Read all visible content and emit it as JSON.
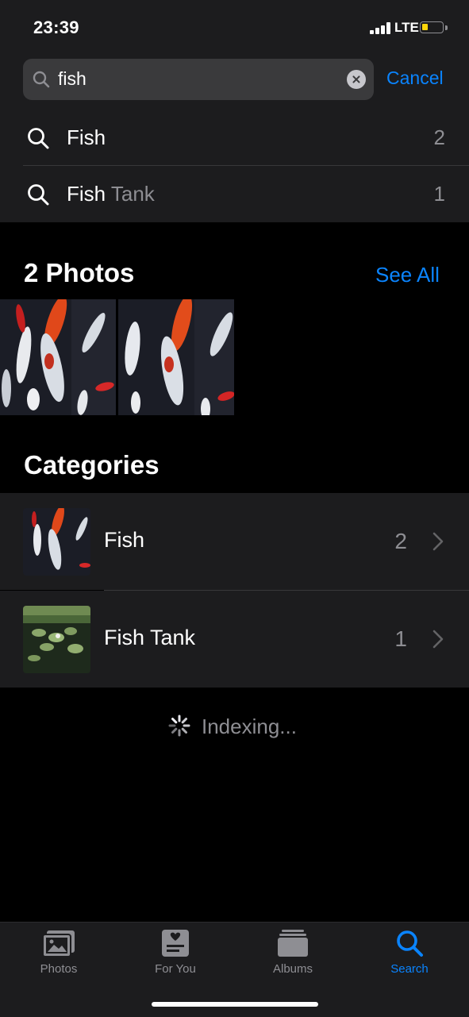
{
  "status_bar": {
    "time": "23:39",
    "network": "LTE"
  },
  "search": {
    "query": "fish",
    "cancel_label": "Cancel"
  },
  "suggestions": [
    {
      "label": "Fish",
      "suffix": "",
      "count": "2"
    },
    {
      "label": "Fish",
      "suffix": " Tank",
      "count": "1"
    }
  ],
  "photos_section": {
    "title": "2 Photos",
    "see_all_label": "See All"
  },
  "categories": {
    "title": "Categories",
    "items": [
      {
        "name": "Fish",
        "count": "2"
      },
      {
        "name": "Fish Tank",
        "count": "1"
      }
    ]
  },
  "indexing_label": "Indexing...",
  "tabs": [
    {
      "label": "Photos",
      "icon": "photos-icon",
      "active": false
    },
    {
      "label": "For You",
      "icon": "for-you-icon",
      "active": false
    },
    {
      "label": "Albums",
      "icon": "albums-icon",
      "active": false
    },
    {
      "label": "Search",
      "icon": "search-icon",
      "active": true
    }
  ],
  "colors": {
    "accent": "#0a84ff",
    "background": "#000000",
    "surface": "#1c1c1e",
    "secondary_text": "#8e8e93"
  }
}
